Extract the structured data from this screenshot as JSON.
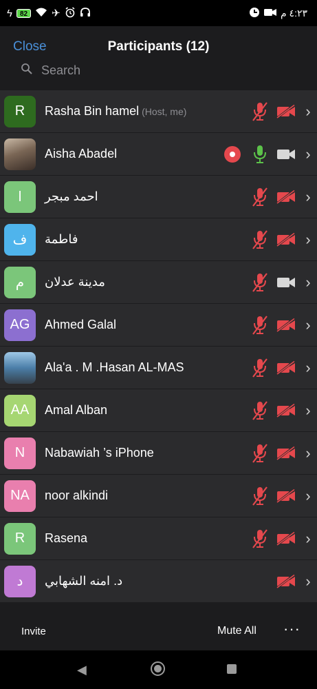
{
  "status_bar": {
    "battery": "82",
    "time": "٤:٢٣ م",
    "icons": [
      "flash-icon",
      "battery-icon",
      "wifi-icon",
      "airplane-icon",
      "alarm-icon",
      "headset-icon",
      "zoom-app-icon",
      "video-icon"
    ]
  },
  "header": {
    "close_label": "Close",
    "title": "Participants (12)",
    "search_placeholder": "Search"
  },
  "participants": [
    {
      "initials": "R",
      "name": "Rasha Bin hamel",
      "tag": "(Host, me)",
      "avatar_color": "#2e6b1f",
      "recording": false,
      "mic": "muted",
      "video": "off"
    },
    {
      "initials": "",
      "name": "Aisha Abadel",
      "tag": "",
      "avatar_color": "photo",
      "recording": true,
      "mic": "on",
      "video": "on"
    },
    {
      "initials": "ا",
      "name": "احمد مبجر",
      "tag": "",
      "avatar_color": "#7bc67a",
      "recording": false,
      "mic": "muted",
      "video": "off"
    },
    {
      "initials": "ف",
      "name": "فاطمة",
      "tag": "",
      "avatar_color": "#4fb4ec",
      "recording": false,
      "mic": "muted",
      "video": "off"
    },
    {
      "initials": "م",
      "name": "مدينة عدلان",
      "tag": "",
      "avatar_color": "#7bc67a",
      "recording": false,
      "mic": "muted",
      "video": "on"
    },
    {
      "initials": "AG",
      "name": "Ahmed Galal",
      "tag": "",
      "avatar_color": "#8c6fd0",
      "recording": false,
      "mic": "muted",
      "video": "off"
    },
    {
      "initials": "",
      "name": "Ala'a . M .Hasan AL-MAS",
      "tag": "",
      "avatar_color": "photo2",
      "recording": false,
      "mic": "muted",
      "video": "off"
    },
    {
      "initials": "AA",
      "name": "Amal Alban",
      "tag": "",
      "avatar_color": "#a6d672",
      "recording": false,
      "mic": "muted",
      "video": "off"
    },
    {
      "initials": "N",
      "name": "Nabawiah ’s iPhone",
      "tag": "",
      "avatar_color": "#e97fae",
      "recording": false,
      "mic": "muted",
      "video": "off"
    },
    {
      "initials": "NA",
      "name": "noor alkindi",
      "tag": "",
      "avatar_color": "#e97fae",
      "recording": false,
      "mic": "muted",
      "video": "off"
    },
    {
      "initials": "R",
      "name": "Rasena",
      "tag": "",
      "avatar_color": "#7bc67a",
      "recording": false,
      "mic": "muted",
      "video": "off"
    },
    {
      "initials": "د",
      "name": "د. امنه الشهابي",
      "tag": "",
      "avatar_color": "#c07ad4",
      "recording": false,
      "mic": "none",
      "video": "off"
    }
  ],
  "footer": {
    "invite_label": "Invite",
    "mute_all_label": "Mute All",
    "more_label": "···"
  },
  "navbar": {
    "icons": [
      "back-icon",
      "home-icon",
      "recents-icon"
    ]
  },
  "colors": {
    "accent": "#4a90d9",
    "muted_red": "#e5484d",
    "mic_on_green": "#5cc24a"
  }
}
